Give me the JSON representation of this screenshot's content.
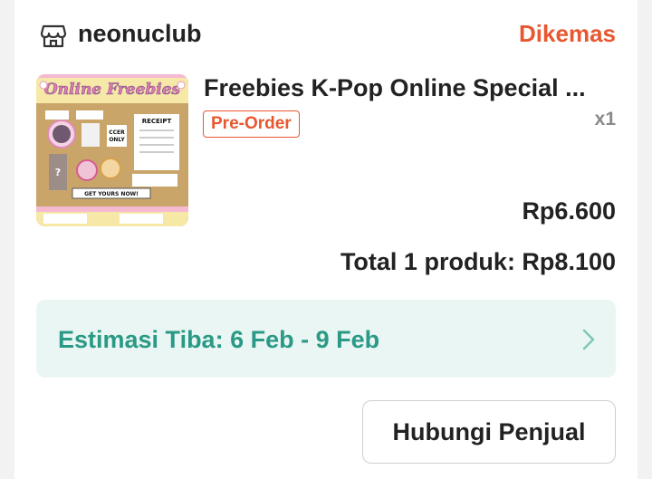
{
  "shop": {
    "name": "neonuclub",
    "icon": "store-icon"
  },
  "order": {
    "status": "Dikemas",
    "status_color": "#e8572f"
  },
  "product": {
    "title": "Freebies K-Pop Online Special ...",
    "badge": "Pre-Order",
    "badge_color": "#e8572f",
    "quantity": "x1",
    "price": "Rp6.600",
    "image_texts": {
      "header": "Online Freebies",
      "receipt": "RECEIPT",
      "cta": "GET YOURS NOW!"
    }
  },
  "summary": {
    "total_text": "Total 1 produk: Rp8.100"
  },
  "shipping": {
    "estimate_text": "Estimasi Tiba: 6 Feb - 9 Feb",
    "text_color": "#2a9a86",
    "bg_color": "#eaf6f3",
    "chevron_icon": "chevron-right-icon"
  },
  "actions": {
    "contact_seller": "Hubungi Penjual"
  }
}
